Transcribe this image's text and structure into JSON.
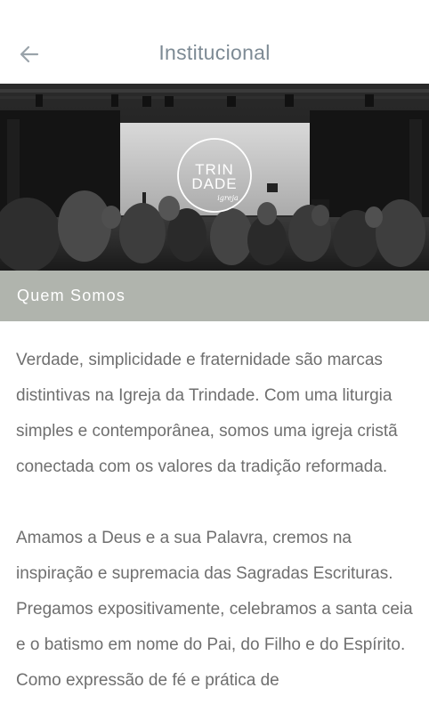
{
  "header": {
    "title": "Institucional",
    "back_icon": "arrow-left-icon"
  },
  "hero": {
    "logo_line1": "TRIN",
    "logo_line2": "DADE",
    "logo_script": "igreja"
  },
  "section": {
    "title": "Quem Somos"
  },
  "content": {
    "paragraphs": [
      "Verdade, simplicidade e fraternidade são marcas distintivas na Igreja da Trindade. Com uma liturgia simples e contemporânea, somos uma igreja cristã conectada com os valores da tradição reformada.",
      "Amamos a Deus e a sua Palavra, cremos na inspiração e supremacia das Sagradas Escrituras. Pregamos expositivamente, celebramos a santa ceia e o batismo em nome do Pai, do Filho e do Espírito. Como expressão de fé e prática de"
    ]
  },
  "colors": {
    "title_text": "#7d8a94",
    "section_bar": "#b0b4ad",
    "body_text": "#6f6f6f"
  }
}
